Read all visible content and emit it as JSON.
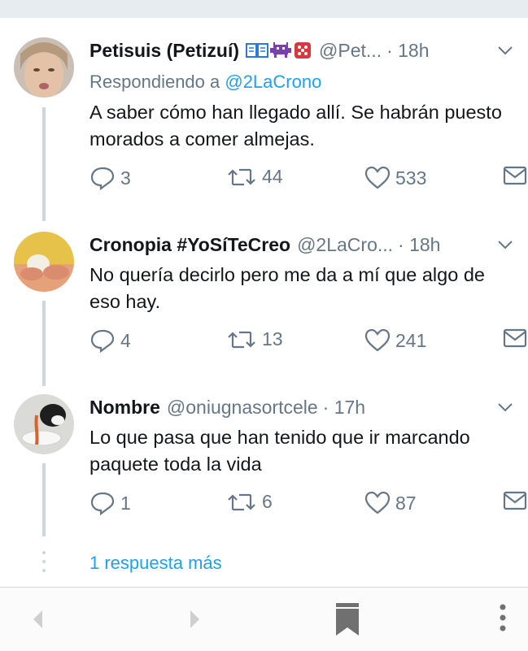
{
  "tweets": [
    {
      "name": "Petisuis (Petizuí)",
      "emojis": [
        "book-emoji",
        "space-invader-emoji",
        "dice-emoji"
      ],
      "handle": "@Pet...",
      "time": "· 18h",
      "reply_prefix": "Respondiendo a ",
      "reply_mention": "@2LaCrono",
      "text": "A saber cómo han llegado allí. Se habrán puesto morados a comer almejas.",
      "replies": "3",
      "retweets": "44",
      "likes": "533"
    },
    {
      "name": "Cronopia #YoSíTeCreo",
      "handle": "@2LaCro...",
      "time": "· 18h",
      "text": "No quería decirlo pero me da a mí que algo de eso hay.",
      "replies": "4",
      "retweets": "13",
      "likes": "241"
    },
    {
      "name": "Nombre",
      "handle": "@oniugnasortcele",
      "time": "· 17h",
      "text": "Lo que pasa que han tenido que ir marcando paquete toda la vida",
      "replies": "1",
      "retweets": "6",
      "likes": "87"
    }
  ],
  "more_replies": "1 respuesta más",
  "colors": {
    "accent": "#1da1f2",
    "muted": "#657786",
    "text": "#14171a",
    "thread_line": "#ccd6dd"
  }
}
